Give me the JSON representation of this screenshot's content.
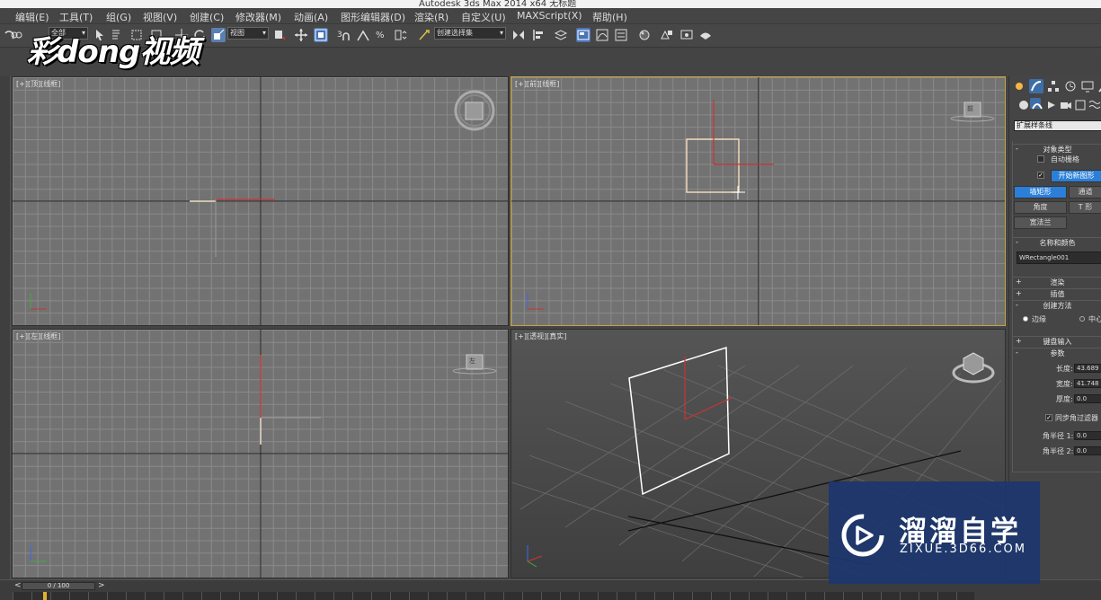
{
  "window": {
    "title": "Autodesk 3ds Max  2014 x64    无标题"
  },
  "menu": [
    "编辑(E)",
    "工具(T)",
    "组(G)",
    "视图(V)",
    "创建(C)",
    "修改器(M)",
    "动画(A)",
    "图形编辑器(D)",
    "渲染(R)",
    "自定义(U)",
    "MAXScript(X)",
    "帮助(H)"
  ],
  "toolbar": {
    "filter_select": "全部",
    "refcoord_select": "视图",
    "named_selection_placeholder": "创建选择集",
    "snap_value": "3"
  },
  "logo_text": "彩dong视频",
  "viewports": {
    "top": {
      "label": "[+][顶][线框]"
    },
    "front": {
      "label": "[+][前][线框]",
      "viewcube": "前"
    },
    "left": {
      "label": "[+][左][线框]",
      "viewcube": "左"
    },
    "perspective": {
      "label": "[+][透视][真实]"
    }
  },
  "command_panel": {
    "category_select": "扩展样条线",
    "object_type": {
      "header": "对象类型",
      "autogrid": "自动栅格",
      "start_new_shape": "开始新图形",
      "buttons": [
        "墙矩形",
        "通道",
        "角度",
        "T 形",
        "宽法兰"
      ]
    },
    "name_color": {
      "header": "名称和颜色",
      "name": "WRectangle001"
    },
    "rollouts": {
      "rendering": "渲染",
      "interpolation": "插值",
      "creation_method": "创建方法",
      "keyboard_entry": "键盘输入",
      "parameters": "参数"
    },
    "creation_method": {
      "edge": "边缘",
      "center": "中心"
    },
    "parameters": {
      "length_label": "长度:",
      "length": "43.689",
      "width_label": "宽度:",
      "width": "41.748",
      "thickness_label": "厚度:",
      "thickness": "0.0",
      "sync_corner": "同步角过滤器",
      "radius1_label": "角半径 1:",
      "radius1": "0.0",
      "radius2_label": "角半径 2:",
      "radius2": "0.0"
    }
  },
  "timeline": {
    "frame": "0 / 100"
  },
  "watermark": {
    "title": "溜溜自学",
    "url": "ZIXUE.3D66.COM"
  },
  "colors": {
    "active_viewport": "#c9a33a",
    "blue_button": "#2b7fd8",
    "x_axis": "#cc3333",
    "y_axis": "#44aa44",
    "z_axis": "#4466ee"
  }
}
